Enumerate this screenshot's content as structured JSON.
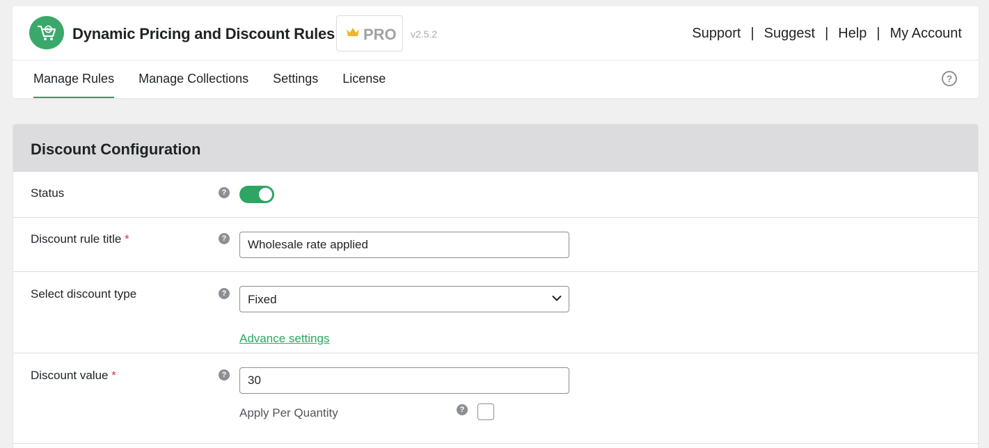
{
  "app": {
    "title": "Dynamic Pricing and Discount Rules",
    "badge": "PRO",
    "version": "v2.5.2",
    "brand_color": "#3aa86a",
    "accent_color": "#2ea563"
  },
  "top_links": [
    {
      "label": "Support"
    },
    {
      "label": "Suggest"
    },
    {
      "label": "Help"
    },
    {
      "label": "My Account"
    }
  ],
  "separator": "|",
  "tabs": [
    {
      "label": "Manage Rules",
      "active": true
    },
    {
      "label": "Manage Collections",
      "active": false
    },
    {
      "label": "Settings",
      "active": false
    },
    {
      "label": "License",
      "active": false
    }
  ],
  "help_icon_glyph": "?",
  "section": {
    "title": "Discount Configuration"
  },
  "fields": {
    "status": {
      "label": "Status",
      "enabled": true
    },
    "rule_title": {
      "label": "Discount rule title",
      "required": "*",
      "value": "Wholesale rate applied"
    },
    "discount_type": {
      "label": "Select discount type",
      "selected": "Fixed",
      "advance_link": "Advance settings"
    },
    "discount_value": {
      "label": "Discount value",
      "required": "*",
      "value": "30",
      "apply_per_quantity_label": "Apply Per Quantity",
      "apply_per_quantity_checked": false
    }
  },
  "tooltip_glyph": "?"
}
